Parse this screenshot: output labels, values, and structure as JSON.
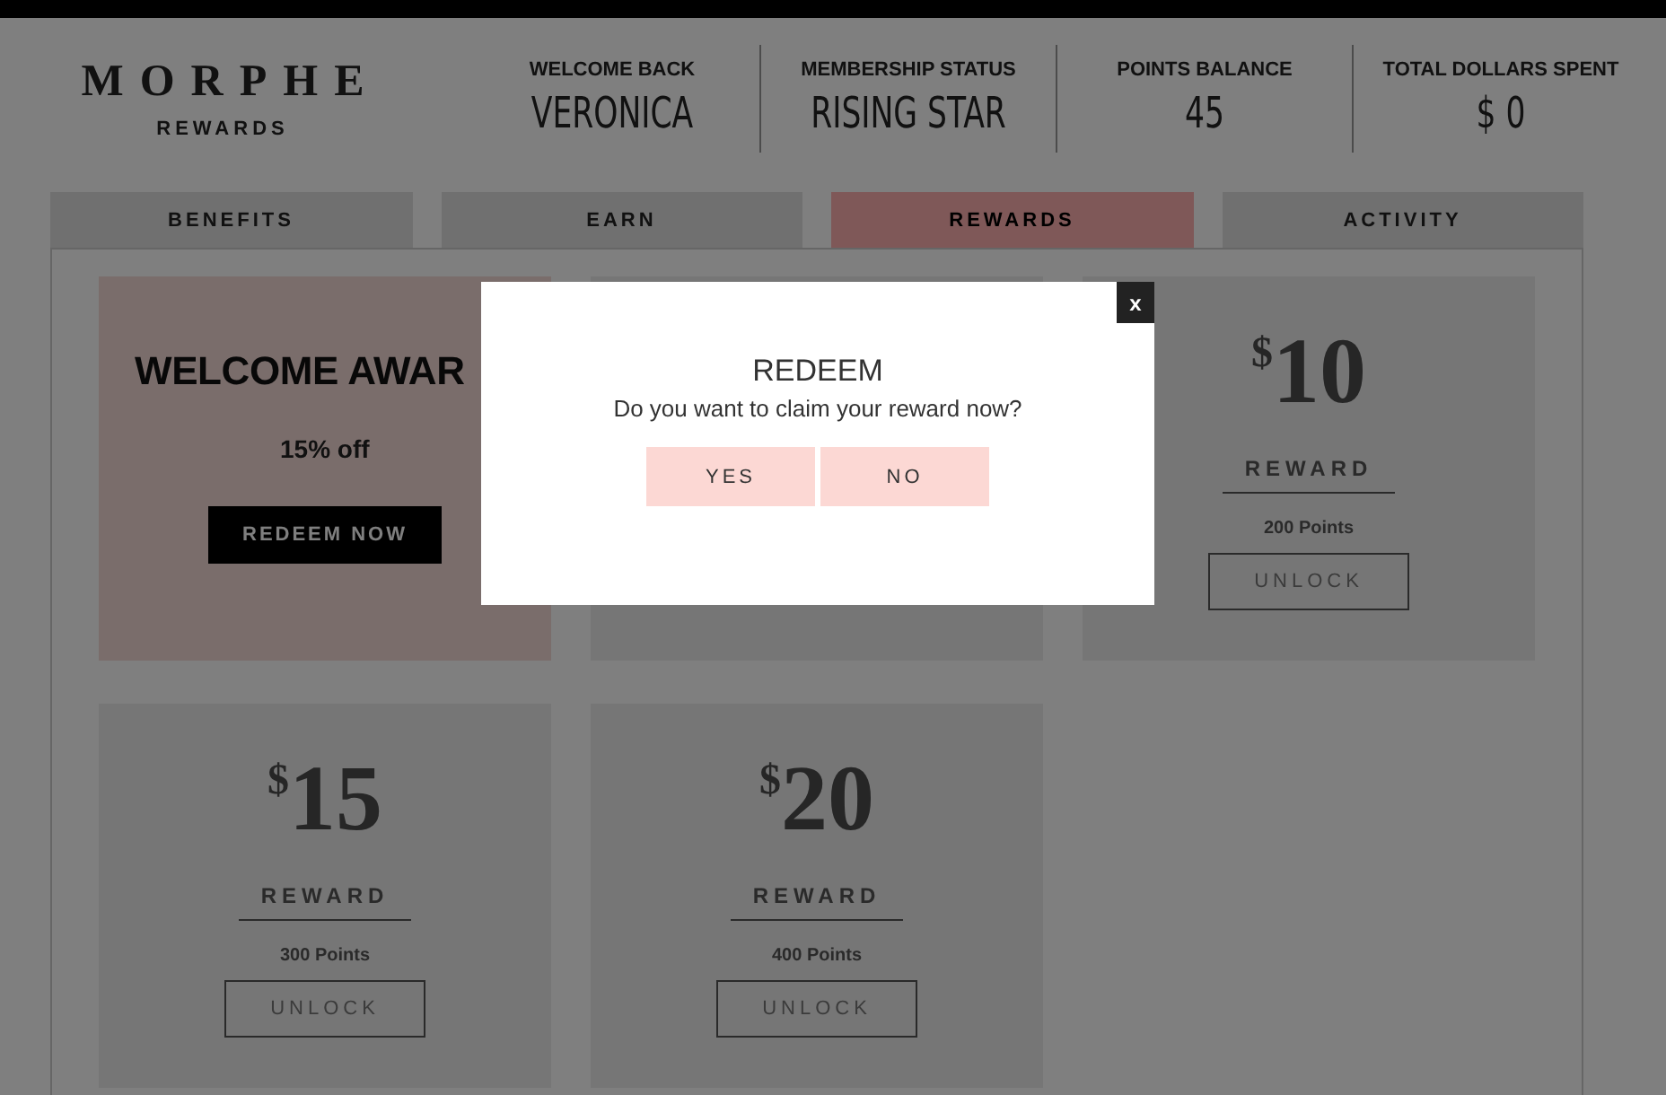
{
  "brand": {
    "name": "MORPHE",
    "subtitle": "REWARDS"
  },
  "stats": [
    {
      "label": "WELCOME BACK",
      "value": "VERONICA"
    },
    {
      "label": "MEMBERSHIP STATUS",
      "value": "RISING STAR"
    },
    {
      "label": "POINTS BALANCE",
      "value": "45"
    },
    {
      "label": "TOTAL DOLLARS SPENT",
      "value": "$ 0"
    }
  ],
  "tabs": [
    {
      "label": "BENEFITS",
      "selected": false
    },
    {
      "label": "EARN",
      "selected": false
    },
    {
      "label": "REWARDS",
      "selected": true
    },
    {
      "label": "ACTIVITY",
      "selected": false
    }
  ],
  "cards": [
    {
      "kind": "promo",
      "title": "WELCOME AWAR",
      "offer": "15% off",
      "button": "REDEEM NOW"
    },
    {
      "kind": "covered"
    },
    {
      "kind": "tier",
      "currency": "$",
      "amount": "10",
      "label": "REWARD",
      "points": "200 Points",
      "button": "UNLOCK"
    },
    {
      "kind": "tier",
      "currency": "$",
      "amount": "15",
      "label": "REWARD",
      "points": "300 Points",
      "button": "UNLOCK"
    },
    {
      "kind": "tier",
      "currency": "$",
      "amount": "20",
      "label": "REWARD",
      "points": "400 Points",
      "button": "UNLOCK"
    }
  ],
  "modal": {
    "close": "x",
    "title": "REDEEM",
    "message": "Do you want to claim your reward now?",
    "buttons": [
      "YES",
      "NO"
    ]
  }
}
